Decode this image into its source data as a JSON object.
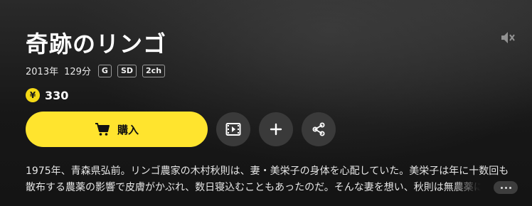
{
  "title": "奇跡のリンゴ",
  "meta": {
    "year": "2013年",
    "duration": "129分",
    "tags": [
      "G",
      "SD",
      "2ch"
    ]
  },
  "price": {
    "coin_symbol": "¥",
    "value": "330"
  },
  "actions": {
    "buy_label": "購入",
    "trailer_icon": "film-play-icon",
    "add_icon": "plus-icon",
    "share_icon": "share-icon",
    "mute_icon": "speaker-muted-icon"
  },
  "synopsis": "1975年、青森県弘前。リンゴ農家の木村秋則は、妻・美栄子の身体を心配していた。美栄子は年に十数回も散布する農薬の影響で皮膚がかぶれ、数日寝込むこともあったのだ。そんな妻を想い、秋則は無農薬によ",
  "colors": {
    "accent": "#ffe42e",
    "coin": "#f5d916",
    "background": "#141414"
  }
}
